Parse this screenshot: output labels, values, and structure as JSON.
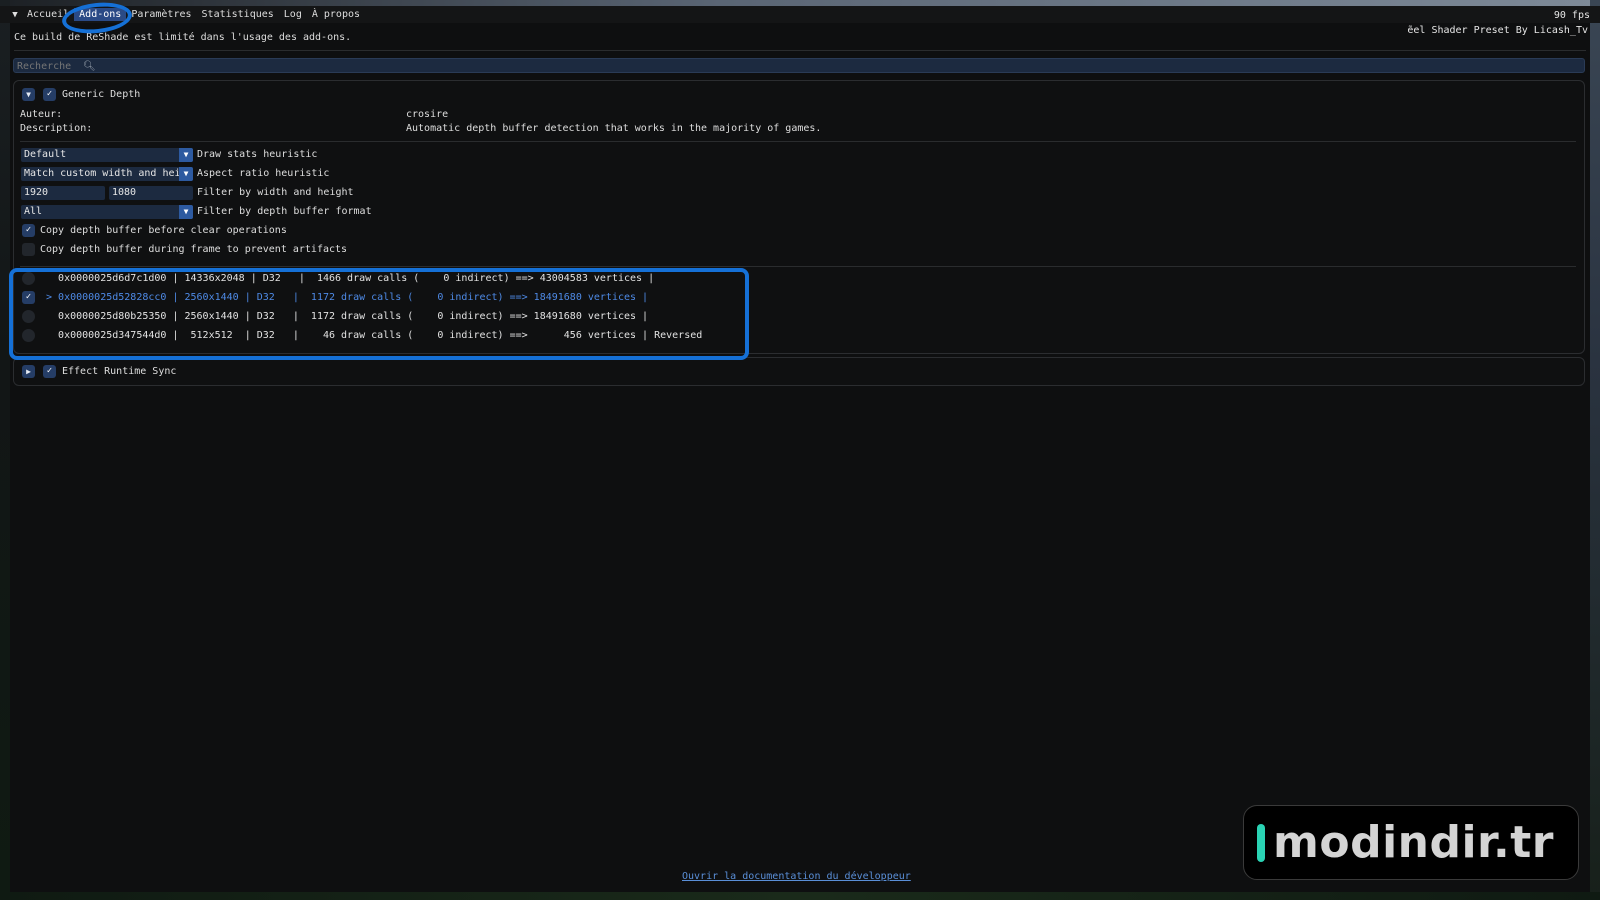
{
  "menu": {
    "collapse_icon": "collapse-triangle-icon",
    "items": [
      {
        "label": "Accueil"
      },
      {
        "label": "Add-ons",
        "active": true
      },
      {
        "label": "Paramètres"
      },
      {
        "label": "Statistiques"
      },
      {
        "label": "Log"
      },
      {
        "label": "À propos"
      }
    ]
  },
  "fps": "90 fps",
  "preset_text": "ẽel Shader Preset By Licash_Tv",
  "notice": "Ce build de ReShade est limité dans l'usage des add-ons.",
  "search": {
    "placeholder": "Recherche",
    "icon": "search-icon"
  },
  "addon_generic_depth": {
    "name": "Generic Depth",
    "expanded": true,
    "enabled": true,
    "author_label": "Auteur:",
    "author_value": "crosire",
    "description_label": "Description:",
    "description_value": "Automatic depth buffer detection that works in the majority of games.",
    "settings": {
      "draw_stats": {
        "value": "Default",
        "label": "Draw stats heuristic"
      },
      "aspect_ratio": {
        "value": "Match custom width and height",
        "label": "Aspect ratio heuristic"
      },
      "filter_size": {
        "width": "1920",
        "height": "1080",
        "label": "Filter by width and height"
      },
      "depth_format": {
        "value": "All",
        "label": "Filter by depth buffer format"
      },
      "copy_before_clear": {
        "checked": true,
        "label": "Copy depth buffer before clear operations"
      },
      "copy_during_frame": {
        "checked": false,
        "label": "Copy depth buffer during frame to prevent artifacts"
      }
    },
    "depth_buffers": [
      {
        "selected": false,
        "text": "   0x0000025d6d7c1d00 | 14336x2048 | D32   |  1466 draw calls (    0 indirect) ==> 43004583 vertices |"
      },
      {
        "selected": true,
        "text": " > 0x0000025d52828cc0 | 2560x1440 | D32   |  1172 draw calls (    0 indirect) ==> 18491680 vertices |"
      },
      {
        "selected": false,
        "text": "   0x0000025d80b25350 | 2560x1440 | D32   |  1172 draw calls (    0 indirect) ==> 18491680 vertices |"
      },
      {
        "selected": false,
        "text": "   0x0000025d347544d0 |  512x512  | D32   |    46 draw calls (    0 indirect) ==>      456 vertices | Reversed"
      }
    ]
  },
  "addon_effect_runtime_sync": {
    "name": "Effect Runtime Sync",
    "expanded": false,
    "enabled": true
  },
  "doc_link": "Ouvrir la documentation du développeur",
  "watermark": "modindir.tr",
  "colors": {
    "accent": "#2d5aa0",
    "annotation": "#1570d6",
    "selected_row": "#4e8ae6",
    "watermark_bar": "#2ad3b4"
  }
}
